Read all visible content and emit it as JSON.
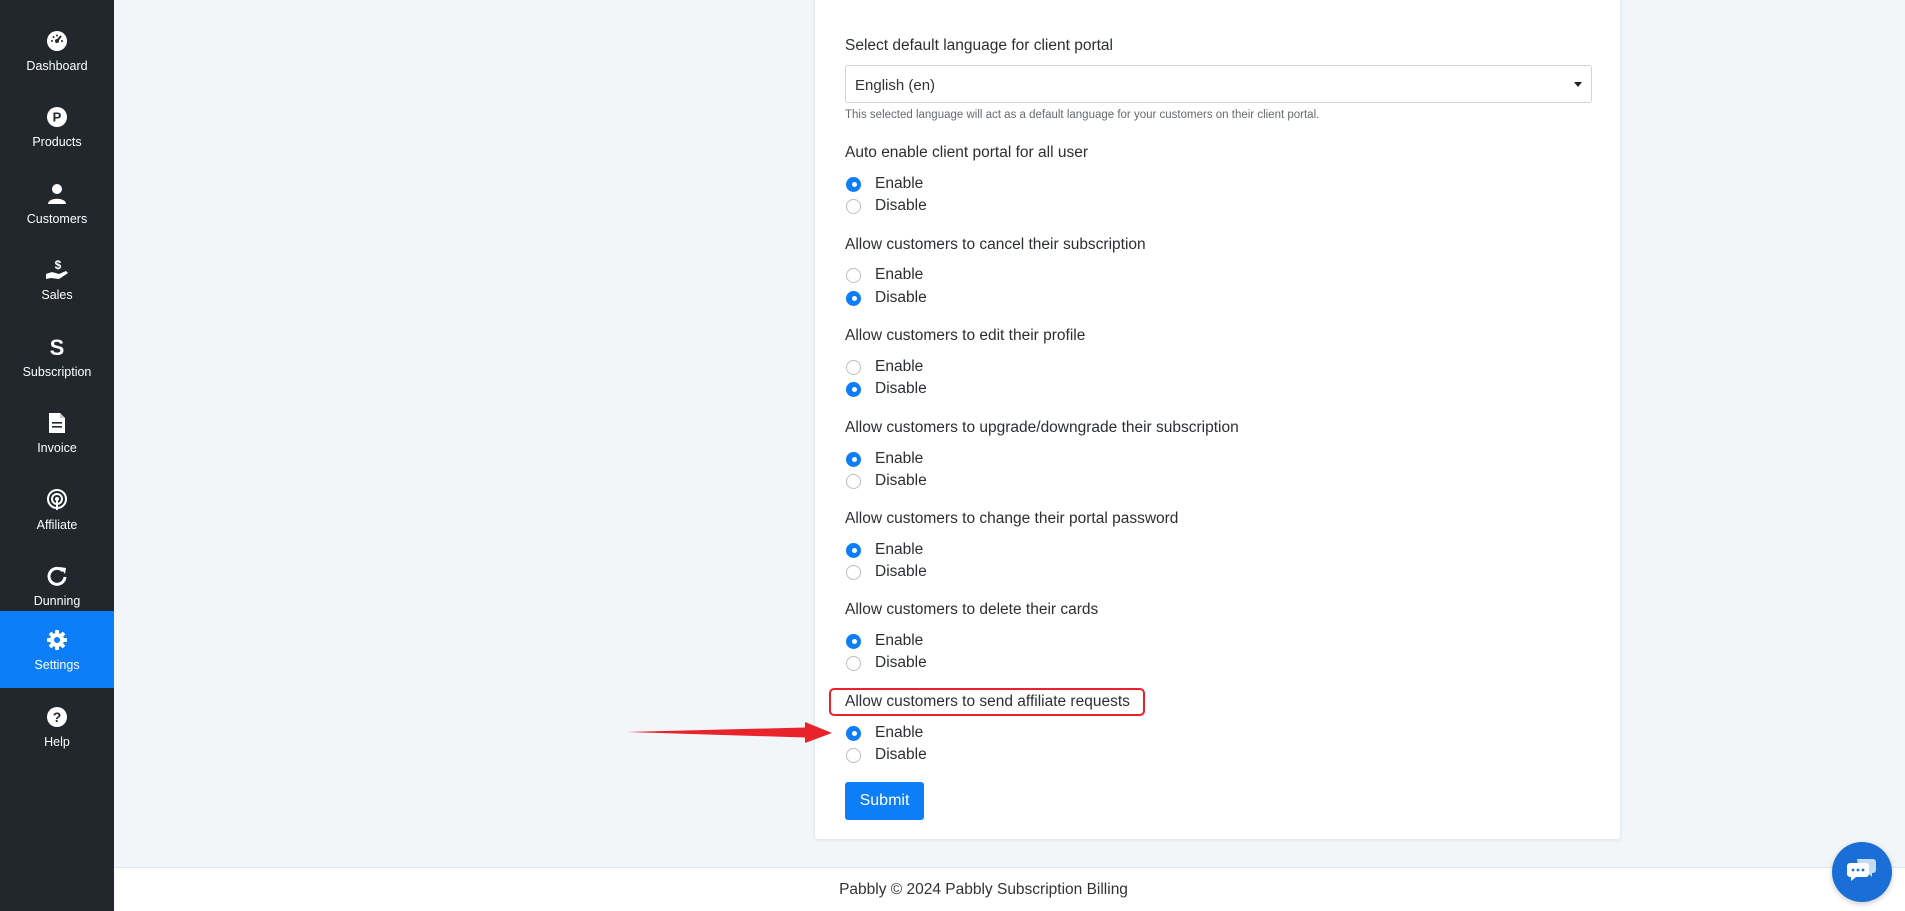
{
  "sidebar": {
    "items": [
      {
        "label": "Dashboard",
        "icon": "speedometer-icon"
      },
      {
        "label": "Products",
        "icon": "product-p-icon"
      },
      {
        "label": "Customers",
        "icon": "user-icon"
      },
      {
        "label": "Sales",
        "icon": "hand-dollar-icon"
      },
      {
        "label": "Subscription",
        "icon": "subscription-s-icon"
      },
      {
        "label": "Invoice",
        "icon": "document-icon"
      },
      {
        "label": "Affiliate",
        "icon": "broadcast-icon"
      },
      {
        "label": "Dunning",
        "icon": "refresh-icon"
      },
      {
        "label": "Settings",
        "icon": "gear-icon",
        "active": true
      },
      {
        "label": "Help",
        "icon": "question-icon"
      }
    ]
  },
  "portal": {
    "language_label": "Select default language for client portal",
    "language_value": "English (en)",
    "language_help": "This selected language will act as a default language for your customers on their client portal.",
    "enable_label": "Enable",
    "disable_label": "Disable",
    "settings": [
      {
        "label": "Auto enable client portal for all user",
        "selected": "Enable"
      },
      {
        "label": "Allow customers to cancel their subscription",
        "selected": "Disable"
      },
      {
        "label": "Allow customers to edit their profile",
        "selected": "Disable"
      },
      {
        "label": "Allow customers to upgrade/downgrade their subscription",
        "selected": "Enable"
      },
      {
        "label": "Allow customers to change their portal password",
        "selected": "Enable"
      },
      {
        "label": "Allow customers to delete their cards",
        "selected": "Enable"
      },
      {
        "label": "Allow customers to send affiliate requests",
        "selected": "Enable"
      }
    ],
    "submit_label": "Submit"
  },
  "footer": {
    "text": "Pabbly © 2024 Pabbly Subscription Billing"
  },
  "colors": {
    "sidebar_bg": "#22272d",
    "accent": "#0d7ef8",
    "annotation": "#e8232b"
  }
}
